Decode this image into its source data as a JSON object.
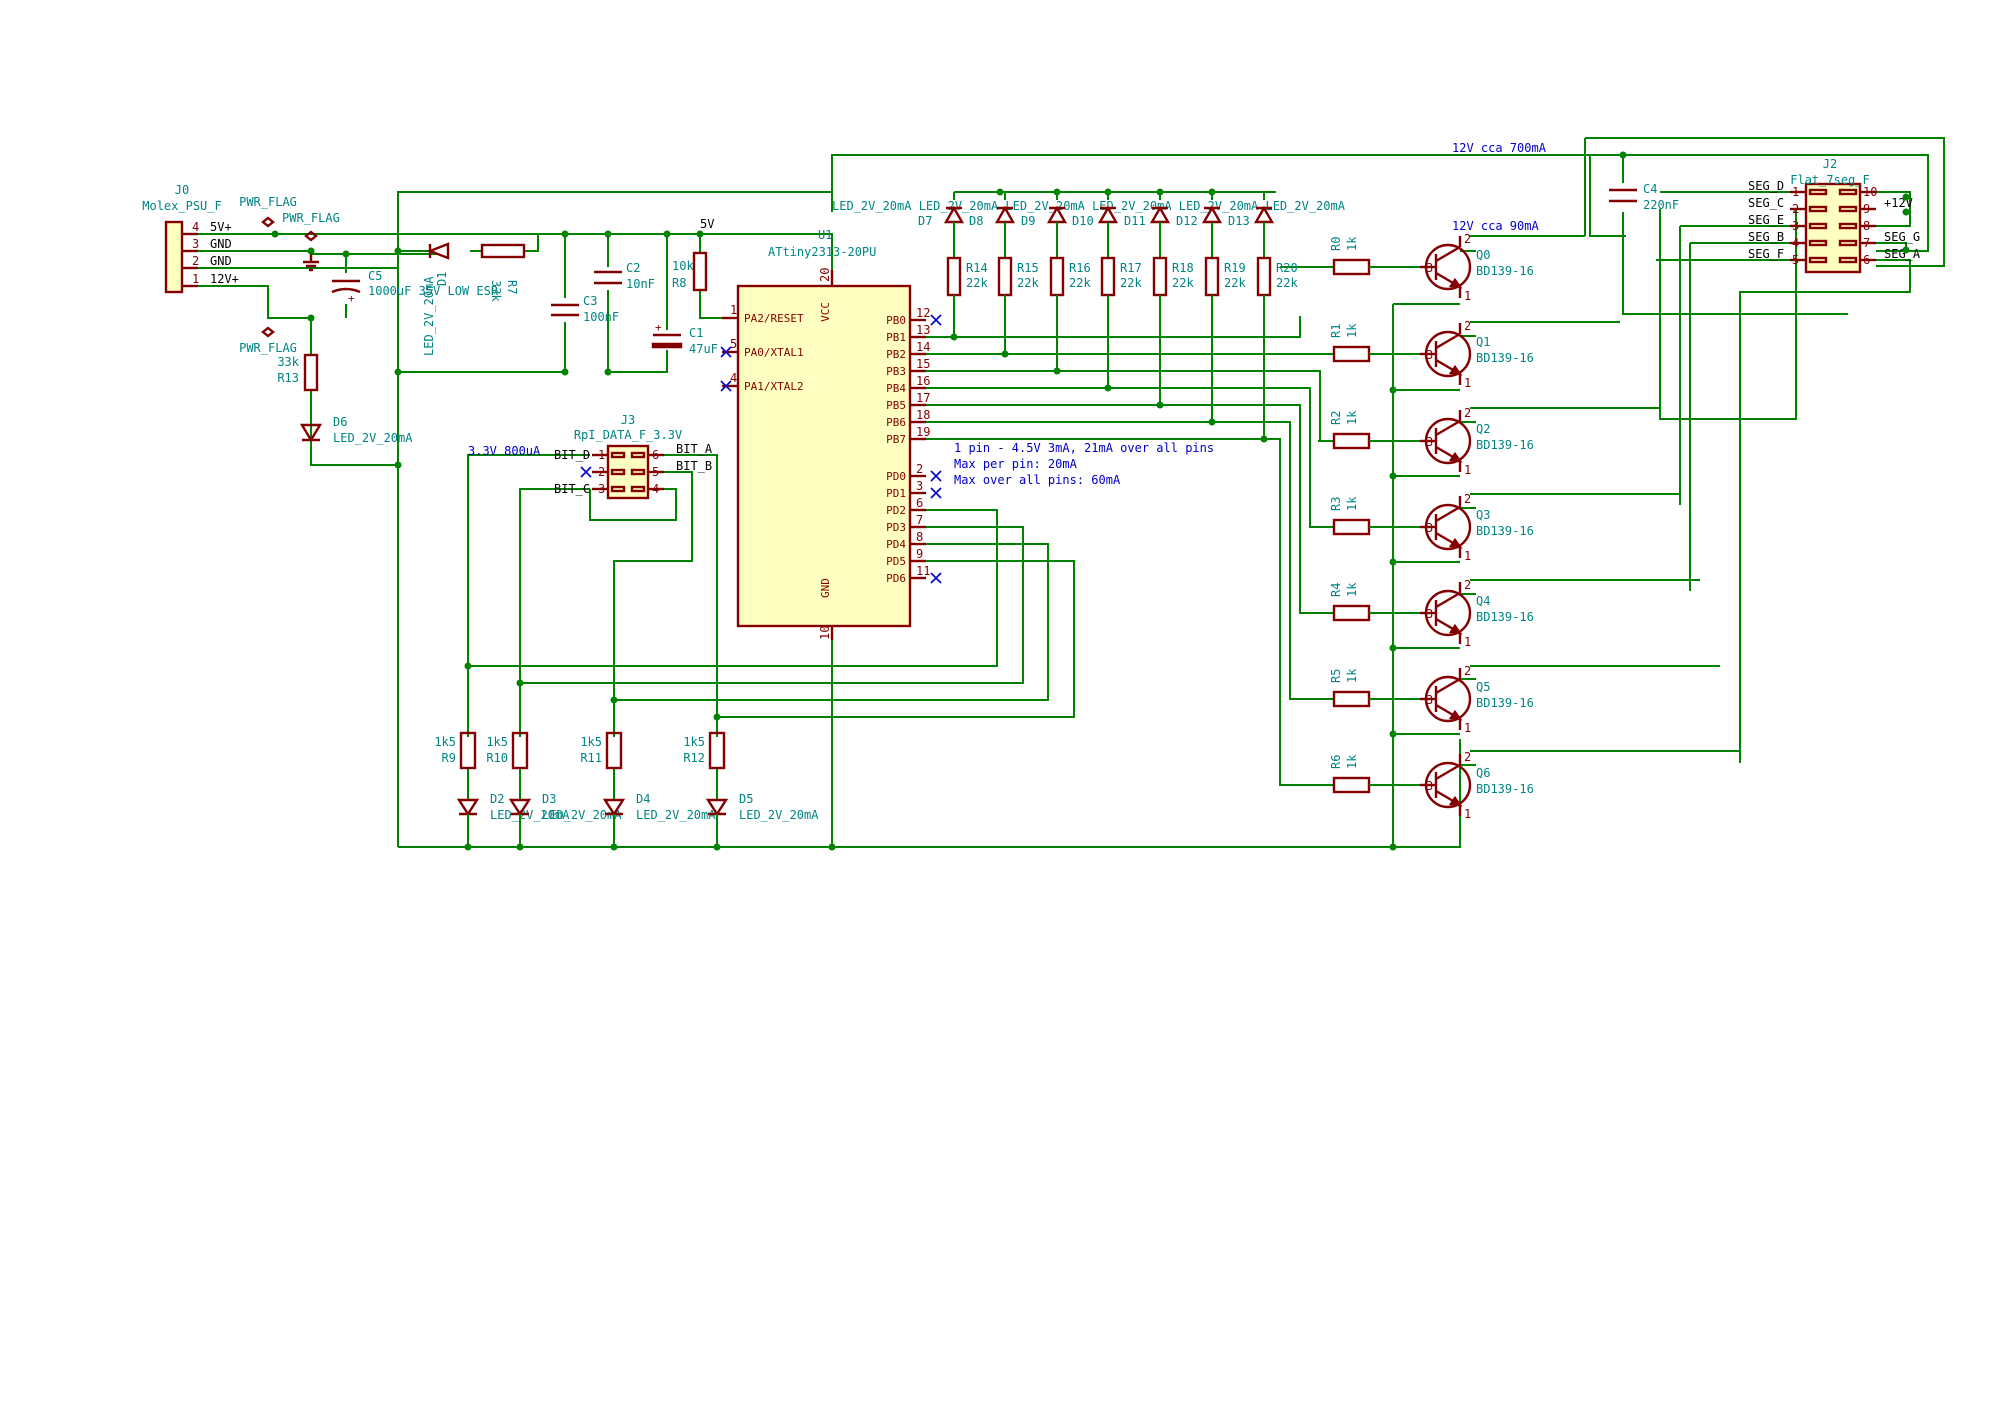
{
  "power": {
    "pwr_flag_1": "PWR_FLAG",
    "pwr_flag_2": "PWR_FLAG",
    "pwr_flag_3": "PWR_FLAG",
    "net_5v": "5V"
  },
  "connectors": {
    "j0": {
      "ref": "J0",
      "value": "Molex_PSU_F",
      "pins": [
        {
          "num": "4",
          "net": "5V+"
        },
        {
          "num": "3",
          "net": "GND"
        },
        {
          "num": "2",
          "net": "GND"
        },
        {
          "num": "1",
          "net": "12V+"
        }
      ]
    },
    "j3": {
      "ref": "J3",
      "value": "RpI_DATA_F_3.3V",
      "left_pins": [
        {
          "num": "1",
          "net": "BIT_D"
        },
        {
          "num": "2",
          "net": ""
        },
        {
          "num": "3",
          "net": "BIT_C"
        }
      ],
      "right_pins": [
        {
          "num": "6",
          "net": "BIT_A"
        },
        {
          "num": "5",
          "net": "BIT_B"
        },
        {
          "num": "4",
          "net": ""
        }
      ],
      "note": "3.3V 800uA"
    },
    "j2": {
      "ref": "J2",
      "value": "Flat_7seg_F",
      "left_pins": [
        {
          "num": "1",
          "net": "SEG_D"
        },
        {
          "num": "2",
          "net": "SEG_C"
        },
        {
          "num": "3",
          "net": "SEG_E"
        },
        {
          "num": "4",
          "net": "SEG_B"
        },
        {
          "num": "5",
          "net": "SEG_F"
        }
      ],
      "right_pins": [
        {
          "num": "10",
          "net": ""
        },
        {
          "num": "9",
          "net": "+12V"
        },
        {
          "num": "8",
          "net": ""
        },
        {
          "num": "7",
          "net": "SEG_G"
        },
        {
          "num": "6",
          "net": "SEG_A"
        }
      ]
    }
  },
  "ic": {
    "ref": "U1",
    "value": "ATtiny2313-20PU",
    "vcc_label": "VCC",
    "vcc_pin": "20",
    "gnd_label": "GND",
    "gnd_pin": "10",
    "left_pins": [
      {
        "num": "1",
        "name": "PA2/RESET"
      },
      {
        "num": "5",
        "name": "PA0/XTAL1"
      },
      {
        "num": "4",
        "name": "PA1/XTAL2"
      }
    ],
    "right_pins": [
      {
        "num": "12",
        "name": "PB0"
      },
      {
        "num": "13",
        "name": "PB1"
      },
      {
        "num": "14",
        "name": "PB2"
      },
      {
        "num": "15",
        "name": "PB3"
      },
      {
        "num": "16",
        "name": "PB4"
      },
      {
        "num": "17",
        "name": "PB5"
      },
      {
        "num": "18",
        "name": "PB6"
      },
      {
        "num": "19",
        "name": "PB7"
      },
      {
        "num": "2",
        "name": "PD0"
      },
      {
        "num": "3",
        "name": "PD1"
      },
      {
        "num": "6",
        "name": "PD2"
      },
      {
        "num": "7",
        "name": "PD3"
      },
      {
        "num": "8",
        "name": "PD4"
      },
      {
        "num": "9",
        "name": "PD5"
      },
      {
        "num": "11",
        "name": "PD6"
      }
    ]
  },
  "notes": {
    "line1": "1 pin - 4.5V 3mA, 21mA over all pins",
    "line2": "Max per pin: 20mA",
    "line3": "Max over all pins: 60mA",
    "supply_700": "12V cca 700mA",
    "supply_90": "12V cca 90mA",
    "seg_led_label": "LED_2V_20mA LED_2V_20mA LED_2V_20mA LED_2V_20mA LED_2V_20mA LED_2V_20mA"
  },
  "passives": {
    "c5": {
      "ref": "C5",
      "value": "1000uF 35V LOW ESR"
    },
    "d1": {
      "ref": "D1",
      "value": "LED_2V_20mA"
    },
    "r7": {
      "ref": "R7",
      "value": "33k"
    },
    "c3": {
      "ref": "C3",
      "value": "100nF"
    },
    "c2": {
      "ref": "C2",
      "value": "10nF"
    },
    "r8": {
      "ref": "R8",
      "value": "10k"
    },
    "c1": {
      "ref": "C1",
      "value": "47uF"
    },
    "r13": {
      "ref": "R13",
      "value": "33k"
    },
    "d6": {
      "ref": "D6",
      "value": "LED_2V_20mA"
    },
    "c4": {
      "ref": "C4",
      "value": "220nF"
    }
  },
  "segment_leds": [
    {
      "ref": "D7"
    },
    {
      "ref": "D8"
    },
    {
      "ref": "D9"
    },
    {
      "ref": "D10"
    },
    {
      "ref": "D11"
    },
    {
      "ref": "D12"
    },
    {
      "ref": "D13"
    }
  ],
  "segment_resistors": [
    {
      "ref": "R14",
      "value": "22k"
    },
    {
      "ref": "R15",
      "value": "22k"
    },
    {
      "ref": "R16",
      "value": "22k"
    },
    {
      "ref": "R17",
      "value": "22k"
    },
    {
      "ref": "R18",
      "value": "22k"
    },
    {
      "ref": "R19",
      "value": "22k"
    },
    {
      "ref": "R20",
      "value": "22k"
    }
  ],
  "base_resistors": [
    {
      "ref": "R0",
      "value": "1k"
    },
    {
      "ref": "R1",
      "value": "1k"
    },
    {
      "ref": "R2",
      "value": "1k"
    },
    {
      "ref": "R3",
      "value": "1k"
    },
    {
      "ref": "R4",
      "value": "1k"
    },
    {
      "ref": "R5",
      "value": "1k"
    },
    {
      "ref": "R6",
      "value": "1k"
    }
  ],
  "transistors": [
    {
      "ref": "Q0",
      "value": "BD139-16"
    },
    {
      "ref": "Q1",
      "value": "BD139-16"
    },
    {
      "ref": "Q2",
      "value": "BD139-16"
    },
    {
      "ref": "Q3",
      "value": "BD139-16"
    },
    {
      "ref": "Q4",
      "value": "BD139-16"
    },
    {
      "ref": "Q5",
      "value": "BD139-16"
    },
    {
      "ref": "Q6",
      "value": "BD139-16"
    }
  ],
  "transistor_pins": {
    "b": "3",
    "c": "2",
    "e": "1"
  },
  "indicator_resistors": [
    {
      "ref": "R9",
      "value": "1k5"
    },
    {
      "ref": "R10",
      "value": "1k5"
    },
    {
      "ref": "R11",
      "value": "1k5"
    },
    {
      "ref": "R12",
      "value": "1k5"
    }
  ],
  "indicator_leds": [
    {
      "ref": "D2",
      "value": "LED_2V_20mA"
    },
    {
      "ref": "D3",
      "value": "LED_2V_20mA"
    },
    {
      "ref": "D4",
      "value": "LED_2V_20mA"
    },
    {
      "ref": "D5",
      "value": "LED_2V_20mA"
    }
  ]
}
